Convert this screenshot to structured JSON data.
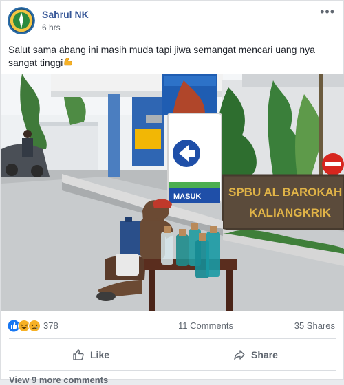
{
  "post": {
    "author": "Sahrul NK",
    "time": "6 hrs",
    "more_glyph": "•••",
    "caption": "Salut sama abang ini masih muda tapi jiwa semangat mencari uang nya sangat tinggi",
    "caption_emoji": "flexed-biceps",
    "photo_signs": {
      "station_line1": "SPBU AL BAROKAH",
      "station_line2": "KALIANGKRIK",
      "entry_sign": "MASUK"
    },
    "stats": {
      "reactions": [
        "like-reaction-icon",
        "haha-reaction-icon",
        "sad-reaction-icon"
      ],
      "reaction_count": "378",
      "comments": "11 Comments",
      "shares": "35 Shares"
    },
    "actions": {
      "like_label": "Like",
      "share_label": "Share"
    },
    "view_more": "View 9 more comments"
  },
  "colors": {
    "link": "#385898",
    "muted": "#606770",
    "like_blue": "#1877f2",
    "haha_yellow": "#f7b125"
  }
}
